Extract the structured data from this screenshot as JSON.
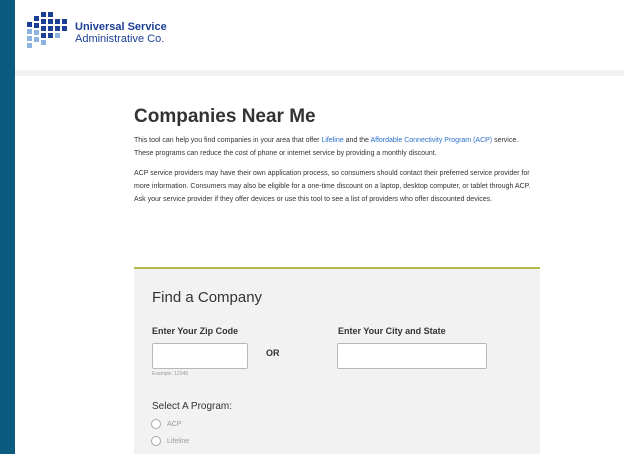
{
  "brand": {
    "name_line1": "Universal Service",
    "name_line2": "Administrative Co.",
    "color": "#1b3f94"
  },
  "page": {
    "title": "Companies Near Me",
    "intro_pre": "This tool can help you find companies in your area that offer ",
    "intro_link1": "Lifeline",
    "intro_mid": " and the ",
    "intro_link2": "Affordable Connectivity Program (ACP)",
    "intro_post": " service. These programs can reduce the cost of phone or internet service by providing a monthly discount.",
    "acp_note": "ACP service providers may have their own application process, so consumers should contact their preferred service provider for more information. Consumers may also be eligible for a one-time discount on a laptop, desktop computer, or tablet through ACP. Ask your service provider if they offer devices or use this tool to see a list of providers who offer discounted devices."
  },
  "finder": {
    "title": "Find a Company",
    "zip_label": "Enter Your Zip Code",
    "zip_value": "",
    "or_text": "OR",
    "city_label": "Enter Your City and State",
    "city_value": "",
    "zip_example": "Example: 12345",
    "program_label": "Select A Program:",
    "programs": [
      {
        "label": "ACP",
        "selected": false
      },
      {
        "label": "Lifeline",
        "selected": false
      }
    ]
  },
  "colors": {
    "outer_background": "#0b5a80",
    "link": "#2a6fcc",
    "card_accent": "#b3b94a",
    "card_background": "#f2f2f2"
  },
  "icons": {
    "logo": "usac-logo-icon"
  }
}
